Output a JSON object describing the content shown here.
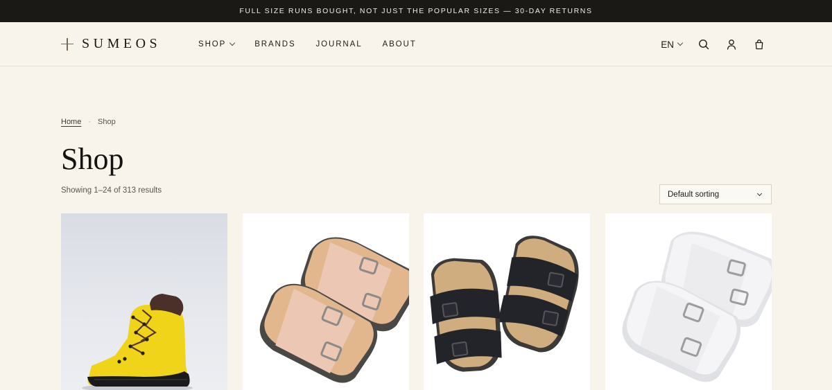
{
  "announcement": "FULL SIZE RUNS BOUGHT, NOT JUST THE POPULAR SIZES — 30-DAY RETURNS",
  "brand": {
    "name": "SUMEOS"
  },
  "nav": {
    "items": [
      {
        "label": "SHOP",
        "has_dropdown": true
      },
      {
        "label": "BRANDS"
      },
      {
        "label": "JOURNAL"
      },
      {
        "label": "ABOUT"
      }
    ]
  },
  "tools": {
    "language": "EN",
    "icons": [
      "search-icon",
      "account-icon",
      "bag-icon"
    ]
  },
  "breadcrumb": {
    "home": "Home",
    "current": "Shop",
    "separator": "·"
  },
  "page": {
    "title": "Shop",
    "results": "Showing 1–24 of 313 results"
  },
  "sort": {
    "selected": "Default sorting"
  },
  "products": [
    {
      "image": "yellow-hiking-boot"
    },
    {
      "image": "beige-suede-double-buckle-sandals"
    },
    {
      "image": "black-leather-double-buckle-sandals"
    },
    {
      "image": "white-double-buckle-sandals"
    }
  ],
  "colors": {
    "announcement_bg": "#1b1916",
    "page_bg": "#f8f4ec",
    "text": "#1d1b18"
  }
}
